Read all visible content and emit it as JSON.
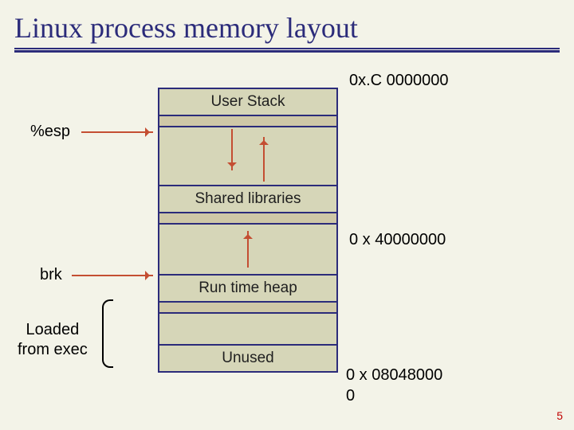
{
  "title": "Linux process memory layout",
  "page_number": "5",
  "addresses": {
    "top": "0x.C 0000000",
    "shared": "0 x 40000000",
    "exec": "0 x 08048000",
    "bottom": "0"
  },
  "pointers": {
    "esp": "%esp",
    "brk": "brk"
  },
  "loaded_from_exec": "Loaded\nfrom exec",
  "segments": {
    "user_stack": "User Stack",
    "shared_libs": "Shared libraries",
    "heap": "Run time heap",
    "unused": "Unused"
  }
}
